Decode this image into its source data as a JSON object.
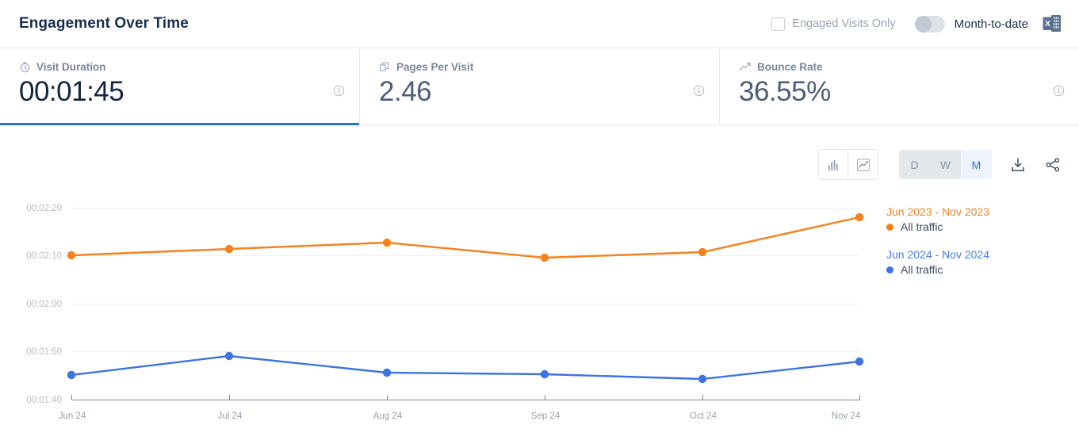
{
  "header": {
    "title": "Engagement Over Time",
    "checkbox": {
      "label": "Engaged Visits Only",
      "checked": false
    },
    "toggle": {
      "label": "Month-to-date",
      "on": false
    },
    "export_icon": "excel-export-icon"
  },
  "cards": [
    {
      "label": "Visit Duration",
      "value": "00:01:45",
      "icon": "clock-icon",
      "active": true
    },
    {
      "label": "Pages Per Visit",
      "value": "2.46",
      "icon": "pages-icon",
      "active": false
    },
    {
      "label": "Bounce Rate",
      "value": "36.55%",
      "icon": "trend-icon",
      "active": false
    }
  ],
  "toolbar": {
    "chart_types": [
      {
        "name": "bar-chart-icon",
        "selected": false
      },
      {
        "name": "line-chart-icon",
        "selected": true
      }
    ],
    "granularity": [
      {
        "label": "D",
        "selected": false
      },
      {
        "label": "W",
        "selected": false
      },
      {
        "label": "M",
        "selected": true
      }
    ],
    "download_label": "download-icon",
    "share_label": "share-icon"
  },
  "legend": [
    {
      "range": "Jun 2023 - Nov 2023",
      "series": "All traffic",
      "color": "#f4821f"
    },
    {
      "range": "Jun 2024 - Nov 2024",
      "series": "All traffic",
      "color": "#3d74dd"
    }
  ],
  "chart_data": {
    "type": "line",
    "title": "Engagement Over Time",
    "xlabel": "",
    "ylabel": "Visit Duration",
    "grid": true,
    "legend_position": "right",
    "categories": [
      "Jun 24",
      "Jul 24",
      "Aug 24",
      "Sep 24",
      "Oct 24",
      "Nov 24"
    ],
    "ytick_labels": [
      "00:02:20",
      "00:02:10",
      "00:02:00",
      "00:01:50",
      "00:01:40"
    ],
    "ytick_seconds": [
      140,
      130,
      120,
      110,
      100
    ],
    "ylim_seconds": [
      100,
      140
    ],
    "series": [
      {
        "name": "All traffic",
        "range": "Jun 2023 - Nov 2023",
        "color": "#f4821f",
        "values": [
          "00:02:09",
          "00:02:11",
          "00:02:12",
          "00:02:09",
          "00:02:10",
          "00:02:17"
        ],
        "values_seconds": [
          129.3,
          130.6,
          131.8,
          128.7,
          129.9,
          137.2
        ]
      },
      {
        "name": "All traffic",
        "range": "Jun 2024 - Nov 2024",
        "color": "#3d74dd",
        "values": [
          "00:01:44",
          "00:01:48",
          "00:01:45",
          "00:01:45",
          "00:01:44",
          "00:01:47"
        ],
        "values_seconds": [
          104.3,
          108.3,
          105.0,
          104.6,
          103.5,
          107.3
        ]
      }
    ]
  }
}
